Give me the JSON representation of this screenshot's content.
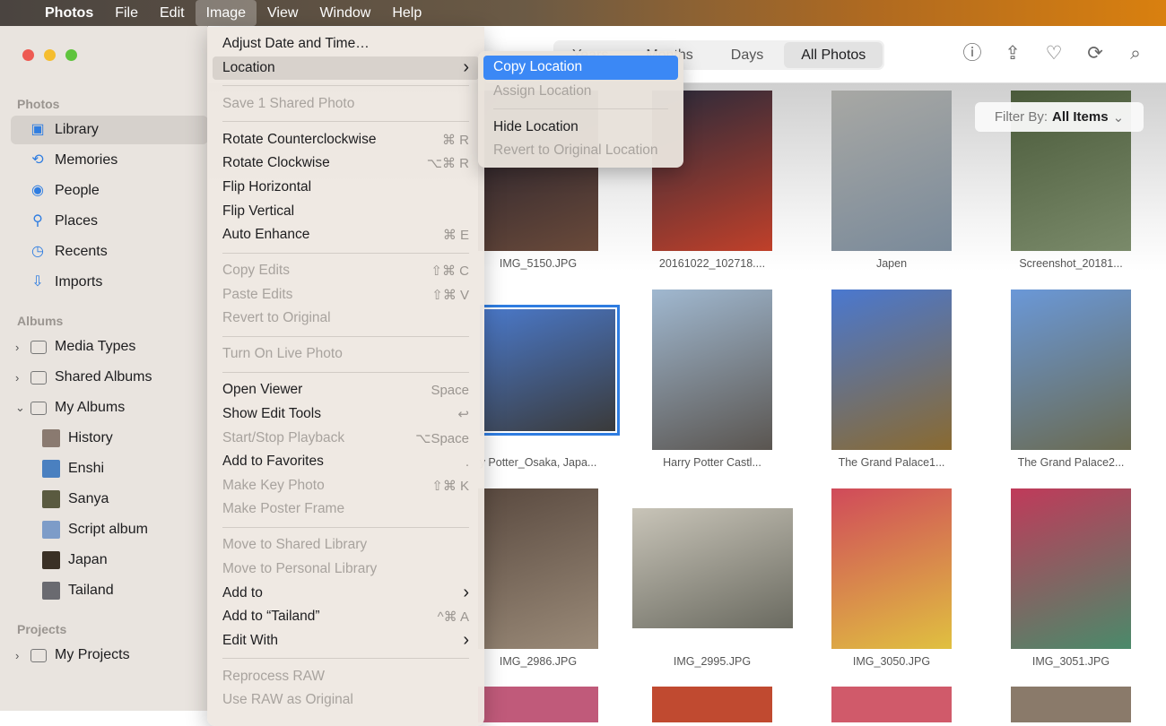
{
  "menubar": {
    "apple": "",
    "items": [
      "Photos",
      "File",
      "Edit",
      "Image",
      "View",
      "Window",
      "Help"
    ],
    "active": "Image"
  },
  "sidebar": {
    "photos_header": "Photos",
    "photos_items": [
      {
        "label": "Library",
        "icon": "library-icon",
        "glyph": "▣"
      },
      {
        "label": "Memories",
        "icon": "memories-icon",
        "glyph": "⟲"
      },
      {
        "label": "People",
        "icon": "people-icon",
        "glyph": "◉"
      },
      {
        "label": "Places",
        "icon": "places-icon",
        "glyph": "⚲"
      },
      {
        "label": "Recents",
        "icon": "recents-icon",
        "glyph": "◷"
      },
      {
        "label": "Imports",
        "icon": "imports-icon",
        "glyph": "⇩"
      }
    ],
    "albums_header": "Albums",
    "album_groups": [
      {
        "label": "Media Types",
        "expanded": false
      },
      {
        "label": "Shared Albums",
        "expanded": false
      },
      {
        "label": "My Albums",
        "expanded": true
      }
    ],
    "my_albums": [
      {
        "label": "History",
        "color": "#8a7a70"
      },
      {
        "label": "Enshi",
        "color": "#4a80c0"
      },
      {
        "label": "Sanya",
        "color": "#5a5a40"
      },
      {
        "label": "Script album",
        "color": "#7d9cc8"
      },
      {
        "label": "Japan",
        "color": "#3a3025"
      },
      {
        "label": "Tailand",
        "color": "#6a6a70"
      }
    ],
    "projects_header": "Projects",
    "projects": [
      {
        "label": "My Projects",
        "expanded": false
      }
    ]
  },
  "toolbar": {
    "segments": [
      "Years",
      "Months",
      "Days",
      "All Photos"
    ],
    "selected": "All Photos",
    "icons": [
      "info-icon",
      "share-icon",
      "heart-icon",
      "rotate-icon",
      "search-icon"
    ]
  },
  "filter": {
    "label": "Filter By:",
    "value": "All Items"
  },
  "photos": [
    {
      "caption": "IMG_5150.JPG",
      "colors": [
        "#1a1a2a",
        "#6a4a3a"
      ]
    },
    {
      "caption": "20161022_102718....",
      "colors": [
        "#2a2a3a",
        "#c0402a"
      ]
    },
    {
      "caption": "Japen",
      "colors": [
        "#a8a8a4",
        "#7a8a9a"
      ]
    },
    {
      "caption": "Screenshot_20181...",
      "colors": [
        "#4a5a3a",
        "#7a8a6a"
      ]
    },
    {
      "caption": "y Potter_Osaka, Japa...",
      "colors": [
        "#4a78c8",
        "#3a3a3a"
      ],
      "selected": true
    },
    {
      "caption": "Harry Potter Castl...",
      "colors": [
        "#a0b8d0",
        "#5a5550"
      ]
    },
    {
      "caption": "The Grand Palace1...",
      "colors": [
        "#4a78d0",
        "#8a6a30"
      ]
    },
    {
      "caption": "The Grand Palace2...",
      "colors": [
        "#6a98d8",
        "#6a6a50"
      ]
    },
    {
      "caption": "IMG_2986.JPG",
      "colors": [
        "#5a4a40",
        "#9a8a78"
      ]
    },
    {
      "caption": "IMG_2995.JPG",
      "colors": [
        "#c8c4b8",
        "#6a6a60"
      ]
    },
    {
      "caption": "IMG_3050.JPG",
      "colors": [
        "#d04a5a",
        "#e0c040"
      ]
    },
    {
      "caption": "IMG_3051.JPG",
      "colors": [
        "#c03a5a",
        "#4a8a6a"
      ]
    }
  ],
  "image_menu": [
    {
      "label": "Adjust Date and Time…"
    },
    {
      "label": "Location",
      "submenu": true,
      "highlighted": true
    },
    {
      "sep": true
    },
    {
      "label": "Save 1 Shared Photo",
      "disabled": true
    },
    {
      "sep": true
    },
    {
      "label": "Rotate Counterclockwise",
      "shortcut": "⌘ R"
    },
    {
      "label": "Rotate Clockwise",
      "shortcut": "⌥⌘ R"
    },
    {
      "label": "Flip Horizontal"
    },
    {
      "label": "Flip Vertical"
    },
    {
      "label": "Auto Enhance",
      "shortcut": "⌘ E"
    },
    {
      "sep": true
    },
    {
      "label": "Copy Edits",
      "shortcut": "⇧⌘ C",
      "disabled": true
    },
    {
      "label": "Paste Edits",
      "shortcut": "⇧⌘ V",
      "disabled": true
    },
    {
      "label": "Revert to Original",
      "disabled": true
    },
    {
      "sep": true
    },
    {
      "label": "Turn On Live Photo",
      "disabled": true
    },
    {
      "sep": true
    },
    {
      "label": "Open Viewer",
      "shortcut": "Space"
    },
    {
      "label": "Show Edit Tools",
      "shortcut": "↩"
    },
    {
      "label": "Start/Stop Playback",
      "shortcut": "⌥Space",
      "disabled": true
    },
    {
      "label": "Add to Favorites",
      "shortcut": "."
    },
    {
      "label": "Make Key Photo",
      "shortcut": "⇧⌘ K",
      "disabled": true
    },
    {
      "label": "Make Poster Frame",
      "disabled": true
    },
    {
      "sep": true
    },
    {
      "label": "Move to Shared Library",
      "disabled": true
    },
    {
      "label": "Move to Personal Library",
      "disabled": true
    },
    {
      "label": "Add to",
      "submenu": true
    },
    {
      "label": "Add to “Tailand”",
      "shortcut": "^⌘ A"
    },
    {
      "label": "Edit With",
      "submenu": true
    },
    {
      "sep": true
    },
    {
      "label": "Reprocess RAW",
      "disabled": true
    },
    {
      "label": "Use RAW as Original",
      "disabled": true
    }
  ],
  "location_submenu": [
    {
      "label": "Copy Location",
      "selected": true
    },
    {
      "label": "Assign Location",
      "disabled": true
    },
    {
      "sep": true
    },
    {
      "label": "Hide Location"
    },
    {
      "label": "Revert to Original Location",
      "disabled": true
    }
  ],
  "colors": {
    "accent": "#3b88f5",
    "close": "#ee5a52",
    "minimize": "#f5bd2e",
    "zoom": "#5fc43d"
  }
}
